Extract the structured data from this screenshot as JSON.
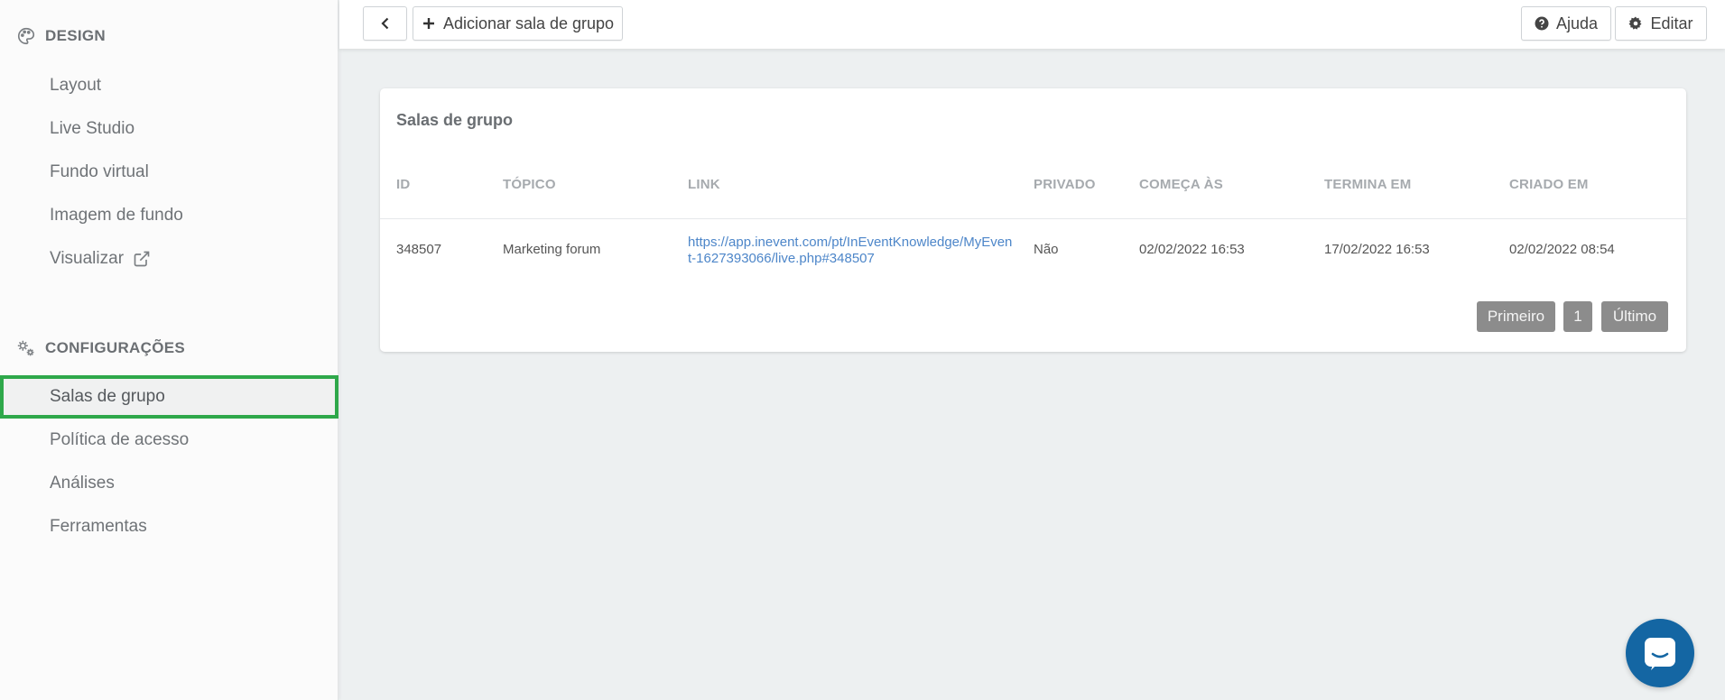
{
  "sidebar": {
    "design": {
      "heading": "DESIGN",
      "icon": "palette-icon",
      "items": [
        {
          "label": "Layout"
        },
        {
          "label": "Live Studio"
        },
        {
          "label": "Fundo virtual"
        },
        {
          "label": "Imagem de fundo"
        },
        {
          "label": "Visualizar",
          "icon": "external-link-icon"
        }
      ]
    },
    "settings": {
      "heading": "CONFIGURAÇÕES",
      "icon": "gears-icon",
      "items": [
        {
          "label": "Salas de grupo",
          "active": true
        },
        {
          "label": "Política de acesso"
        },
        {
          "label": "Análises"
        },
        {
          "label": "Ferramentas"
        }
      ]
    }
  },
  "topbar": {
    "back_icon": "chevron-left-icon",
    "add_label": "Adicionar sala de grupo",
    "help_label": "Ajuda",
    "edit_label": "Editar"
  },
  "card": {
    "title": "Salas de grupo",
    "columns": [
      "ID",
      "TÓPICO",
      "LINK",
      "PRIVADO",
      "COMEÇA ÀS",
      "TERMINA EM",
      "CRIADO EM"
    ],
    "rows": [
      {
        "id": "348507",
        "topic": "Marketing forum",
        "link": "https://app.inevent.com/pt/InEventKnowledge/MyEvent-1627393066/live.php#348507",
        "private": "Não",
        "starts": "02/02/2022 16:53",
        "ends": "17/02/2022 16:53",
        "created": "02/02/2022 08:54"
      }
    ],
    "pagination": {
      "first": "Primeiro",
      "page": "1",
      "last": "Último"
    }
  },
  "colors": {
    "accent_active": "#2ea84a",
    "link": "#4d86c9",
    "chat": "#1466a3",
    "pager": "#8c8c8c"
  }
}
